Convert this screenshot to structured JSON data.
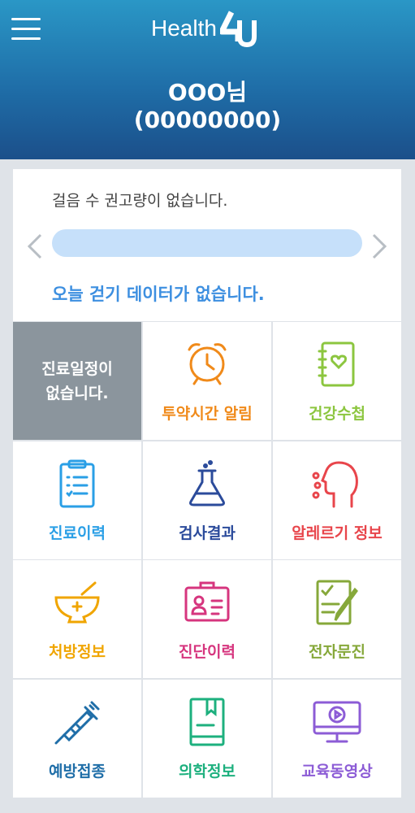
{
  "header": {
    "logo_text": "Health",
    "logo_mark": "4U",
    "user_name": "OOO님",
    "user_id": "(00000000)",
    "menu_icon": "hamburger-menu-icon"
  },
  "walk": {
    "recommendation_text": "걸음 수 권고량이 없습니다.",
    "no_data_text": "오늘 걷기 데이터가 없습니다.",
    "prev_icon": "chevron-left-icon",
    "next_icon": "chevron-right-icon"
  },
  "schedule": {
    "line1": "진료일정이",
    "line2": "없습니다."
  },
  "menu": [
    {
      "label": "투약시간 알림",
      "icon": "alarm-clock-icon",
      "color": "#f08a1a"
    },
    {
      "label": "건강수첩",
      "icon": "health-notebook-icon",
      "color": "#8cc63f"
    },
    {
      "label": "진료이력",
      "icon": "clipboard-checklist-icon",
      "color": "#2a9fe6"
    },
    {
      "label": "검사결과",
      "icon": "lab-flask-icon",
      "color": "#2b4b9b"
    },
    {
      "label": "알레르기 정보",
      "icon": "allergy-head-icon",
      "color": "#e8454b"
    },
    {
      "label": "처방정보",
      "icon": "mortar-pestle-icon",
      "color": "#f0a500"
    },
    {
      "label": "진단이력",
      "icon": "id-card-icon",
      "color": "#d6357e"
    },
    {
      "label": "전자문진",
      "icon": "questionnaire-pen-icon",
      "color": "#86a83a"
    },
    {
      "label": "예방접종",
      "icon": "syringe-icon",
      "color": "#1f6ea8"
    },
    {
      "label": "의학정보",
      "icon": "medical-book-icon",
      "color": "#1db07e"
    },
    {
      "label": "교육동영상",
      "icon": "video-monitor-icon",
      "color": "#8c5cd6"
    }
  ]
}
